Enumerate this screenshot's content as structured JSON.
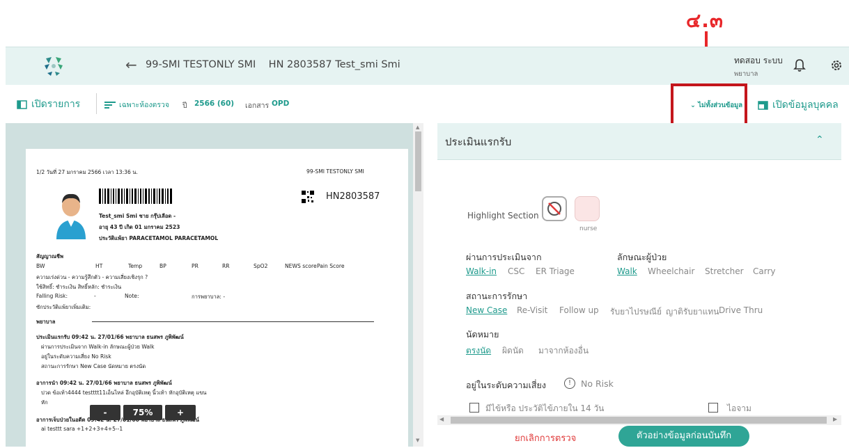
{
  "annotation": {
    "label": "๔.๓",
    "color": "#e8272a"
  },
  "header": {
    "patient_title": "99-SMI TESTONLY SMI    HN 2803587 Test_smi Smi",
    "user_name": "ทดสอบ ระบบ",
    "user_role": "พยาบาล"
  },
  "toolbar": {
    "open_list": "เปิดรายการ",
    "filter": "เฉพาะห้องตรวจ",
    "year_label": "ปี",
    "year_value": "2566 (60)",
    "doc_label": "เอกสาร",
    "doc_value": "OPD",
    "partial_link": "ไม่ทั้งส่วนข้อมูล",
    "open_person": "เปิดข้อมูลบุคคล"
  },
  "document": {
    "page_info": "1/2  วันที่ 27 มกราคม 2566  เวลา 13:36 น.",
    "facility": "99-SMI TESTONLY SMI",
    "hn": "HN2803587",
    "name_line": "Test_smi Smi  ชาย  กรุ๊ปเลือด -",
    "age_line": "อายุ 43 ปี  เกิด 01 มกราคม 2523",
    "allergy_line": "ประวัติแพ้ยา PARACETAMOL PARACETAMOL",
    "vitals_title": "สัญญาณชีพ",
    "vitals_headers": [
      "BW",
      "HT",
      "Temp",
      "BP",
      "PR",
      "RR",
      "SpO2",
      "NEWS score",
      "Pain Score"
    ],
    "urgency_line": "ความเร่งด่วน -   ความรู้สึกตัว -   ความเสี่ยงเชิงรุก ?",
    "rights_line": "ใช้สิทธิ์: ชำระเงิน   สิทธิ์หลัก: ชำระเงิน",
    "falling_label": "Falling Risk:",
    "falling_val": "-",
    "note_label": "Note:",
    "nursing_label": "การพยาบาล: -",
    "more_allergy": "ซักประวัติแพ้ยาเพิ่มเติม:",
    "nurse_heading": "พยาบาล",
    "assess_line": "ประเมินแรกรับ 09:42 น. 27/01/66 พยาบาล ธนสพร ภูพิพัฒน์",
    "assess_1": "ผ่านการประเมินจาก Walk-in  ลักษณะผู้ป่วย Walk",
    "assess_2": "อยู่ในระดับความเสี่ยง No Risk",
    "assess_3": "สถานะการรักษา New Case  นัดหมาย ตรงนัด",
    "cc_line": "อาการนำ 09:42 น. 27/01/66 พยาบาล ธนสพร ภูพิพัฒน์",
    "cc_1": "ปวด ข้อเท้า4444 testttt11เอ็นไหล่ อึกอุบัติเหตุ นิ้วเท้า หักอุบัติเหตุ แขน",
    "cc_2": "หัก",
    "pi_line": "อาการเจ็บป่วยในอดีต 09:42 น. 27/01/66 พยาบาล ธนสพร ภูพิพัฒน์",
    "pi_1": "ai testtt sara +1+2+3+4+5--1"
  },
  "zoom": {
    "minus": "-",
    "value": "75%",
    "plus": "+"
  },
  "assessment": {
    "title": "ประเมินแรกรับ",
    "highlight_label": "Highlight Section",
    "nurse_label": "nurse",
    "source_label": "ผ่านการประเมินจาก",
    "source_options": [
      "Walk-in",
      "CSC",
      "ER Triage"
    ],
    "source_selected": "Walk-in",
    "patient_type_label": "ลักษณะผู้ป่วย",
    "patient_type_options": [
      "Walk",
      "Wheelchair",
      "Stretcher",
      "Carry"
    ],
    "patient_type_selected": "Walk",
    "treatment_label": "สถานะการรักษา",
    "treatment_options": [
      "New Case",
      "Re-Visit",
      "Follow up",
      "รับยาไปรษณีย์",
      "ญาติรับยาแทน",
      "Drive Thru"
    ],
    "treatment_selected": "New Case",
    "appt_label": "นัดหมาย",
    "appt_options": [
      "ตรงนัด",
      "ผิดนัด",
      "มาจากห้องอื่น"
    ],
    "appt_selected": "ตรงนัด",
    "risk_label": "อยู่ในระดับความเสี่ยง",
    "risk_value": "No Risk",
    "check_fever": "มีไข้หรือ ประวัติไข้ภายใน 14 วัน",
    "check_cough": "ไอจาม"
  },
  "footer": {
    "cancel": "ยกเลิกการตรวจ",
    "preview": "ตัวอย่างข้อมูลก่อนบันทึก"
  },
  "colors": {
    "accent": "#1e9a8c",
    "header_bg": "#e6f3f2",
    "annotation": "#c4161c"
  }
}
